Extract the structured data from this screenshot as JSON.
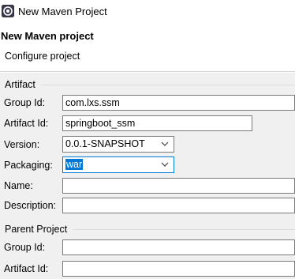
{
  "window": {
    "title": "New Maven Project",
    "icon": "eclipse-app-icon"
  },
  "header": {
    "title": "New Maven project",
    "description": "Configure project"
  },
  "artifact": {
    "group_label": "Artifact",
    "group_id_label": "Group Id:",
    "group_id_value": "com.lxs.ssm",
    "artifact_id_label": "Artifact Id:",
    "artifact_id_value": "springboot_ssm",
    "version_label": "Version:",
    "version_value": "0.0.1-SNAPSHOT",
    "packaging_label": "Packaging:",
    "packaging_value": "war",
    "name_label": "Name:",
    "name_value": "",
    "description_label": "Description:",
    "description_value": ""
  },
  "parent": {
    "group_label": "Parent Project",
    "group_id_label": "Group Id:",
    "group_id_value": "",
    "artifact_id_label": "Artifact Id:",
    "artifact_id_value": ""
  },
  "colors": {
    "body_background": "#f0f0f0",
    "selection": "#0078d7",
    "focus_border": "#0078d7"
  }
}
